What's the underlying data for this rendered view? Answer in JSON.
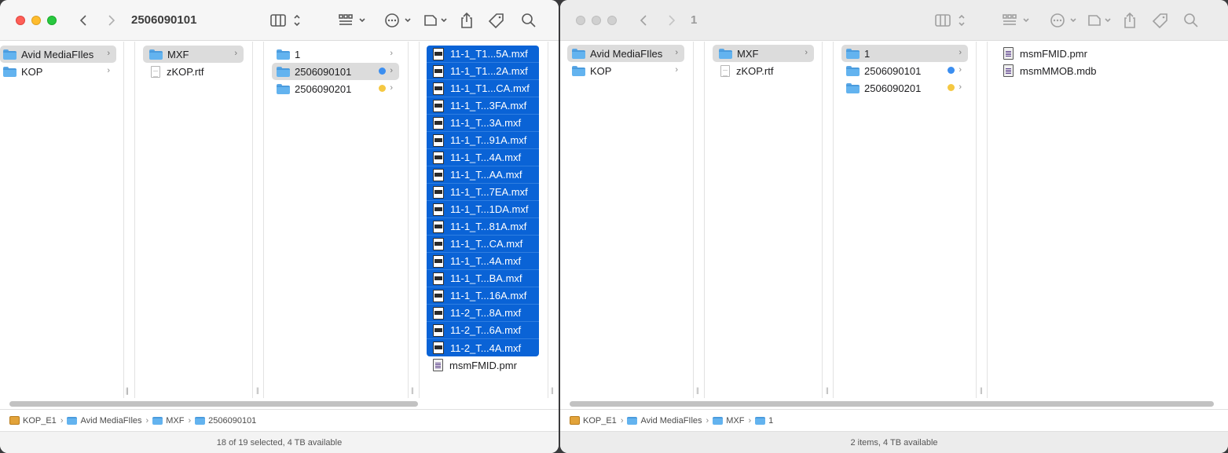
{
  "win1": {
    "title": "2506090101",
    "col1": [
      {
        "label": "Avid MediaFIles",
        "selected": true
      },
      {
        "label": "KOP"
      }
    ],
    "col2": [
      {
        "label": "MXF",
        "selected": true
      },
      {
        "label": "zKOP.rtf"
      }
    ],
    "col3": [
      {
        "label": "1"
      },
      {
        "label": "2506090101",
        "selected": true,
        "tag": "#3b8ef0"
      },
      {
        "label": "2506090201",
        "tag": "#f5c842"
      }
    ],
    "col4": [
      "11-1_T1...5A.mxf",
      "11-1_T1...2A.mxf",
      "11-1_T1...CA.mxf",
      "11-1_T...3FA.mxf",
      "11-1_T...3A.mxf",
      "11-1_T...91A.mxf",
      "11-1_T...4A.mxf",
      "11-1_T...AA.mxf",
      "11-1_T...7EA.mxf",
      "11-1_T...1DA.mxf",
      "11-1_T...81A.mxf",
      "11-1_T...CA.mxf",
      "11-1_T...4A.mxf",
      "11-1_T...BA.mxf",
      "11-1_T...16A.mxf",
      "11-2_T...8A.mxf",
      "11-2_T...6A.mxf",
      "11-2_T...4A.mxf"
    ],
    "col4_last": "msmFMID.pmr",
    "path": [
      "KOP_E1",
      "Avid MediaFIles",
      "MXF",
      "2506090101"
    ],
    "status": "18 of 19 selected, 4 TB available"
  },
  "win2": {
    "title": "1",
    "col1": [
      {
        "label": "Avid MediaFIles",
        "selected": true
      },
      {
        "label": "KOP"
      }
    ],
    "col2": [
      {
        "label": "MXF",
        "selected": true
      },
      {
        "label": "zKOP.rtf"
      }
    ],
    "col3": [
      {
        "label": "1",
        "selected": true
      },
      {
        "label": "2506090101",
        "tag": "#3b8ef0"
      },
      {
        "label": "2506090201",
        "tag": "#f5c842"
      }
    ],
    "col4": [
      "msmFMID.pmr",
      "msmMMOB.mdb"
    ],
    "path": [
      "KOP_E1",
      "Avid MediaFIles",
      "MXF",
      "1"
    ],
    "status": "2 items, 4 TB available"
  },
  "colors": {
    "selection_blue": "#0a63d6",
    "tag_blue": "#3b8ef0",
    "tag_yellow": "#f5c842",
    "folder": "#63b3ef"
  },
  "icons": [
    "back-chevron-icon",
    "forward-chevron-icon",
    "column-view-icon",
    "group-icon",
    "more-icon",
    "tag-action-icon",
    "share-icon",
    "tag-icon",
    "search-icon"
  ]
}
